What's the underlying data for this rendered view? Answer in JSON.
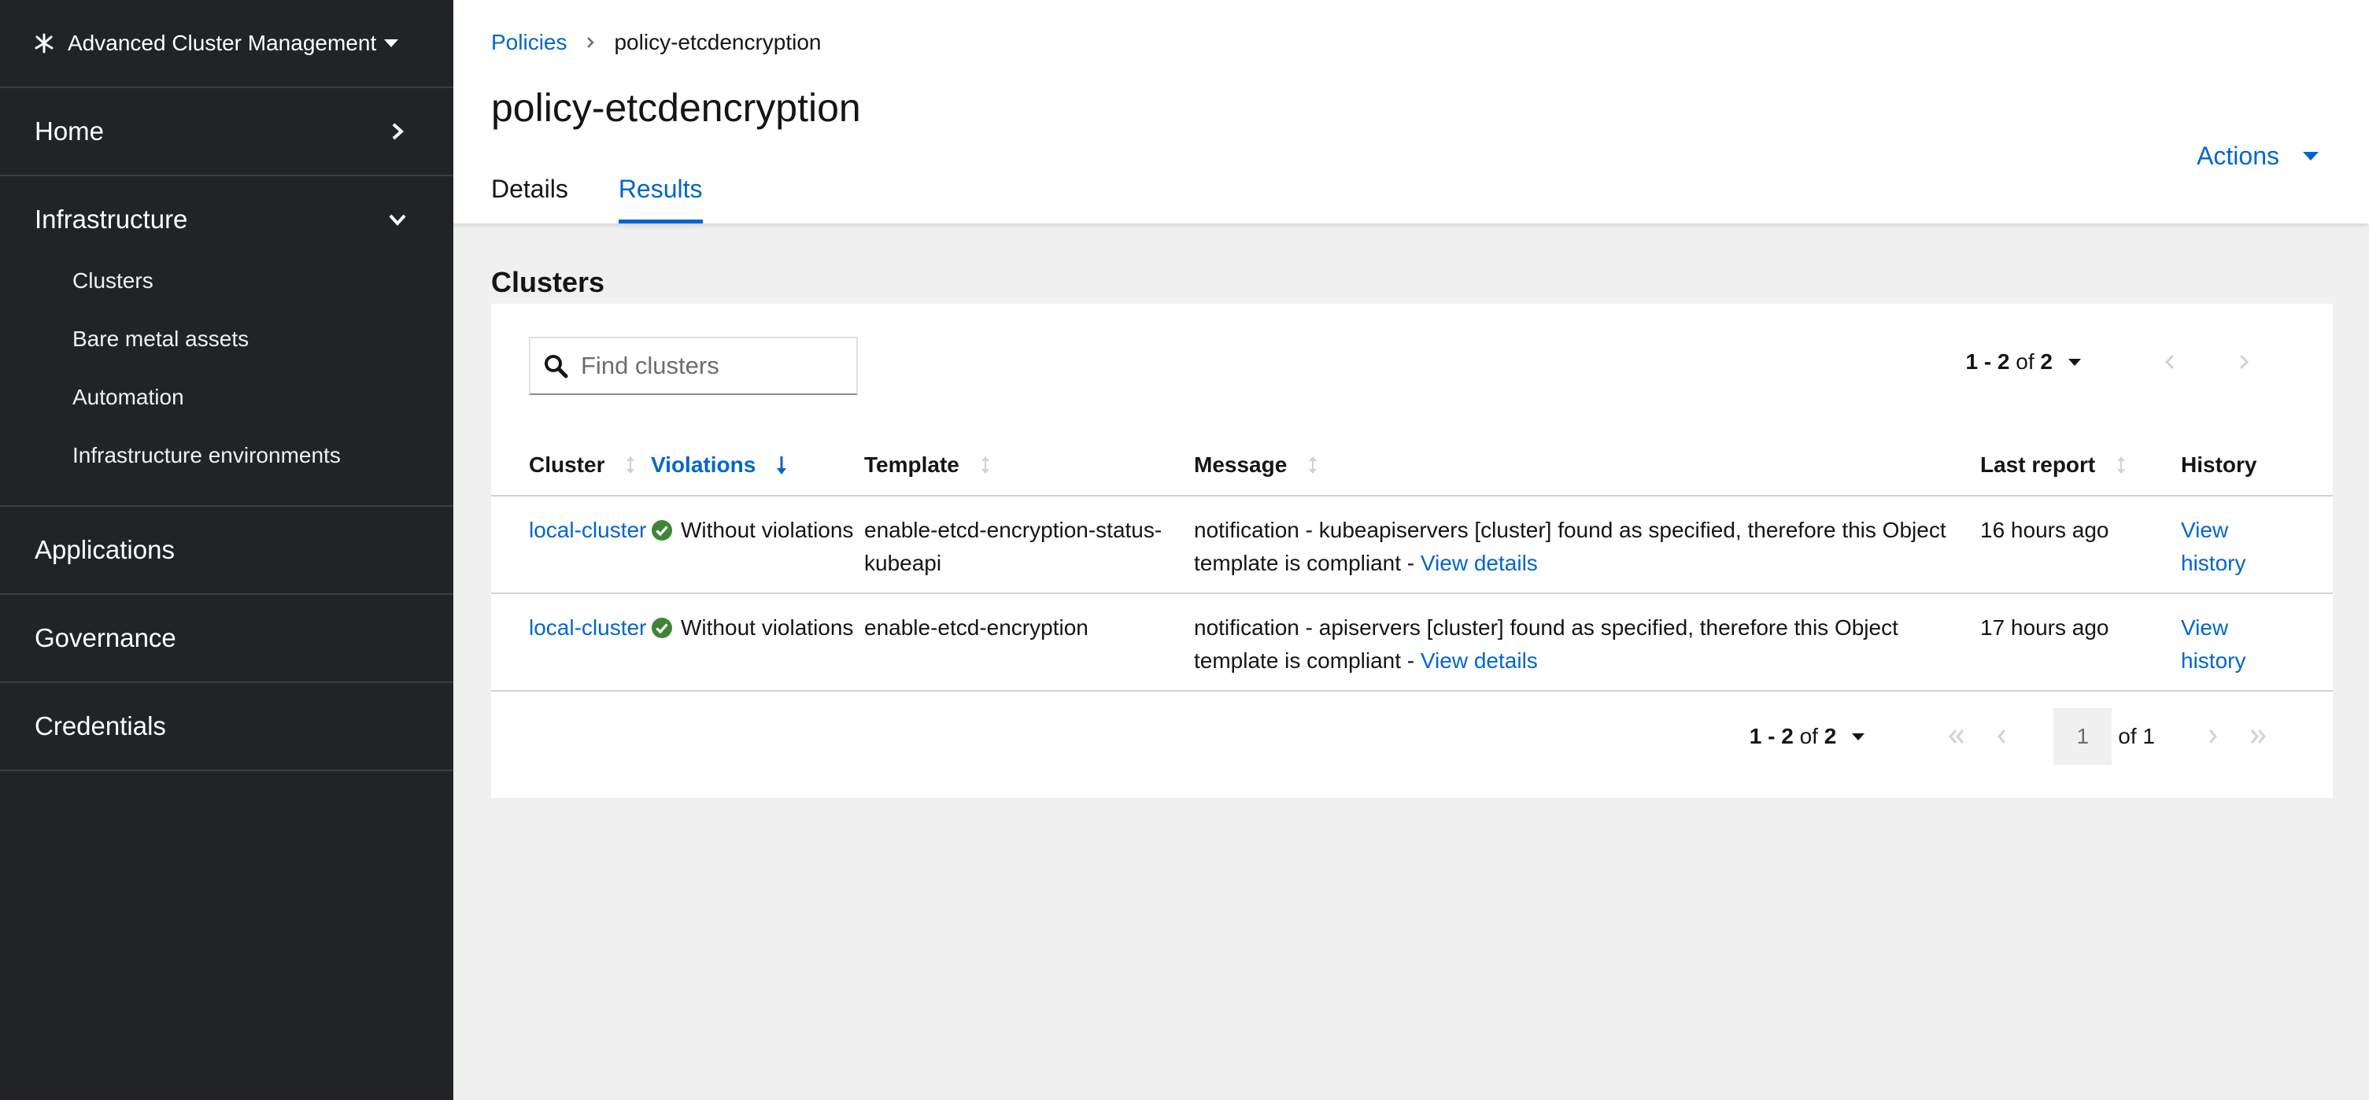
{
  "app": {
    "switcher_label": "Advanced Cluster Management"
  },
  "sidebar": {
    "items": [
      {
        "label": "Home"
      },
      {
        "label": "Infrastructure",
        "children": [
          "Clusters",
          "Bare metal assets",
          "Automation",
          "Infrastructure environments"
        ]
      },
      {
        "label": "Applications"
      },
      {
        "label": "Governance"
      },
      {
        "label": "Credentials"
      }
    ]
  },
  "breadcrumb": {
    "parent": "Policies",
    "current": "policy-etcdencryption"
  },
  "page": {
    "title": "policy-etcdencryption",
    "actions_label": "Actions",
    "tabs": [
      "Details",
      "Results"
    ],
    "active_tab": "Results"
  },
  "clusters": {
    "section_title": "Clusters",
    "search_placeholder": "Find clusters",
    "pagination": {
      "range": "1 - 2",
      "of_label": "of",
      "total": "2",
      "current_page": "1",
      "page_count_label": "of 1"
    },
    "columns": [
      "Cluster",
      "Violations",
      "Template",
      "Message",
      "Last report",
      "History"
    ],
    "sorted_column": "Violations",
    "rows": [
      {
        "cluster": "local-cluster",
        "violations": "Without violations",
        "template": "enable-etcd-encryption-status-kubeapi",
        "message": "notification - kubeapiservers [cluster] found as specified, therefore this Object template is compliant -",
        "message_link": "View details",
        "last_report": "16 hours ago",
        "history": "View history"
      },
      {
        "cluster": "local-cluster",
        "violations": "Without violations",
        "template": "enable-etcd-encryption",
        "message": "notification - apiservers [cluster] found as specified, therefore this Object template is compliant -",
        "message_link": "View details",
        "last_report": "17 hours ago",
        "history": "View history"
      }
    ]
  },
  "colors": {
    "sidebar_bg": "#212427",
    "link": "#0066cc",
    "success": "#3e8635"
  }
}
